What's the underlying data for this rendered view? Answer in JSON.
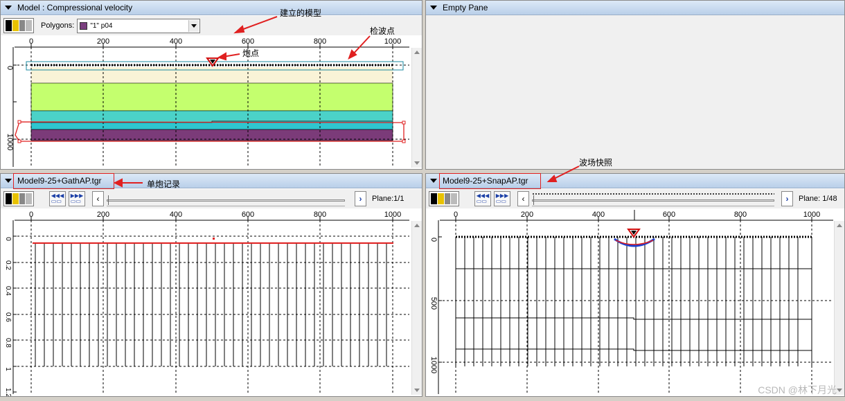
{
  "panes": {
    "model": {
      "title": "Model : Compressional velocity",
      "polygons_label": "Polygons:",
      "polygon_value": "\"1\" p04",
      "x_ticks": [
        "0",
        "200",
        "400",
        "600",
        "800",
        "1000"
      ],
      "y_ticks": [
        "0",
        "1000"
      ]
    },
    "empty": {
      "title": "Empty Pane"
    },
    "gather": {
      "title": "Model9-25+GathAP.tgr",
      "plane": "Plane:1/1",
      "x_ticks": [
        "0",
        "200",
        "400",
        "600",
        "800",
        "1000"
      ],
      "y_ticks": [
        "0",
        "0.2",
        "0.4",
        "0.6",
        "0.8",
        "1",
        "1.2"
      ]
    },
    "snap": {
      "title": "Model9-25+SnapAP.tgr",
      "plane": "Plane: 1/48",
      "x_ticks": [
        "0",
        "200",
        "400",
        "600",
        "800",
        "1000"
      ],
      "y_ticks": [
        "0",
        "500",
        "1000"
      ]
    }
  },
  "annotations": {
    "model_built": "建立的模型",
    "receivers": "检波点",
    "shot_point": "炮点",
    "single_shot": "单炮记录",
    "snapshot": "波场快照"
  },
  "watermark": "CSDN @林下月光",
  "colors": {
    "layer1": "#f9f3d7",
    "layer2": "#c4ff6e",
    "layer3": "#4bd2c8",
    "layer4": "#2fc6cf",
    "layer5": "#7b3b79",
    "highlight": "#e02020",
    "selection": "#1a8aa0"
  }
}
